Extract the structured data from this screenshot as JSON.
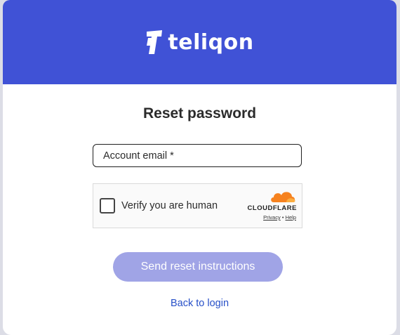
{
  "brand": {
    "name": "teliqon"
  },
  "page": {
    "title": "Reset password"
  },
  "form": {
    "email_label": "Account email *"
  },
  "captcha": {
    "label": "Verify you are human",
    "provider": "CLOUDFLARE",
    "privacy": "Privacy",
    "separator": "•",
    "help": "Help"
  },
  "actions": {
    "send_label": "Send reset instructions",
    "back_label": "Back to login"
  },
  "colors": {
    "header_bg": "#4052d6",
    "button_bg": "#a0a4e6",
    "link": "#2750c8",
    "cloudflare_orange": "#f6821f"
  }
}
